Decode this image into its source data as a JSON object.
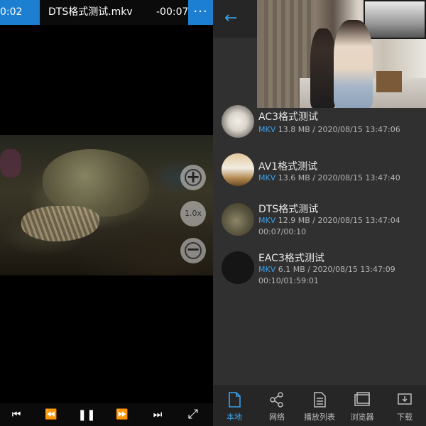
{
  "player": {
    "time_elapsed": "0:02",
    "file_title": "DTS格式测试.mkv",
    "time_remaining": "-00:07",
    "more_label": "···",
    "zoom": {
      "zoom_in": "+",
      "level": "1.0x",
      "zoom_out": "−"
    },
    "controls": {
      "previous": "⏮",
      "rewind": "⏪",
      "pause": "❚❚",
      "fast_forward": "⏩",
      "next": "⏭",
      "fullscreen": "⤢"
    }
  },
  "library": {
    "back_label": "←",
    "items": [
      {
        "title": "AC3格式测试",
        "format": "MKV",
        "details": "13.8 MB / 2020/08/15 13:47:06",
        "progress": ""
      },
      {
        "title": "AV1格式测试",
        "format": "MKV",
        "details": "13.6 MB / 2020/08/15 13:47:40",
        "progress": ""
      },
      {
        "title": "DTS格式测试",
        "format": "MKV",
        "details": "12.9 MB / 2020/08/15 13:47:04",
        "progress": "00:07/00:10"
      },
      {
        "title": "EAC3格式测试",
        "format": "MKV",
        "details": "6.1 MB / 2020/08/15 13:47:09",
        "progress": "00:10/01:59:01"
      }
    ],
    "nav": [
      {
        "label": "本地",
        "icon": "file-icon",
        "active": true
      },
      {
        "label": "网络",
        "icon": "share-icon",
        "active": false
      },
      {
        "label": "播放列表",
        "icon": "playlist-icon",
        "active": false
      },
      {
        "label": "浏览器",
        "icon": "browser-icon",
        "active": false
      },
      {
        "label": "下载",
        "icon": "download-icon",
        "active": false
      }
    ]
  },
  "colors": {
    "accent": "#1d7fd1",
    "accent_text": "#3ba0e8",
    "panel_bg": "#303030"
  }
}
